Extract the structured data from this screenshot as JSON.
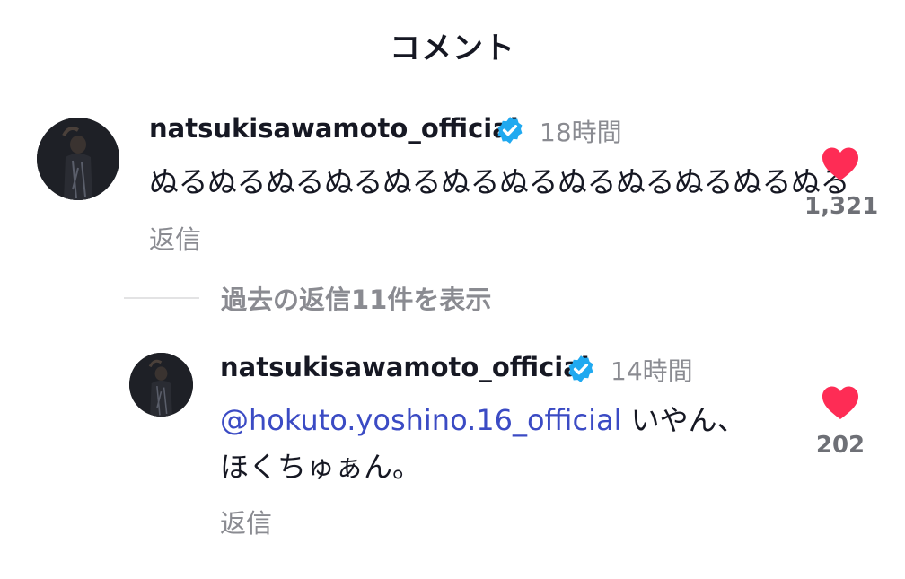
{
  "header": {
    "title": "コメント"
  },
  "comments": [
    {
      "username": "natsukisawamoto_official",
      "verified": true,
      "time": "18時間",
      "text": "ぬるぬるぬるぬるぬるぬるぬるぬるぬるぬるぬるぬる",
      "reply_label": "返信",
      "likes": "1,321"
    }
  ],
  "view_replies": {
    "label": "過去の返信11件を表示"
  },
  "replies": [
    {
      "username": "natsukisawamoto_official",
      "verified": true,
      "time": "14時間",
      "mention": "@hokuto.yoshino.16_official",
      "text_line1": " いやん、",
      "text_line2": "ほくちゅぁん。",
      "reply_label": "返信",
      "likes": "202"
    }
  ],
  "colors": {
    "heart": "#fe2c55",
    "verified": "#20d5ec",
    "mention": "#3b4bc4",
    "muted": "#8a8b91"
  },
  "icons": {
    "verified": "verified-badge-icon",
    "like": "heart-icon"
  }
}
